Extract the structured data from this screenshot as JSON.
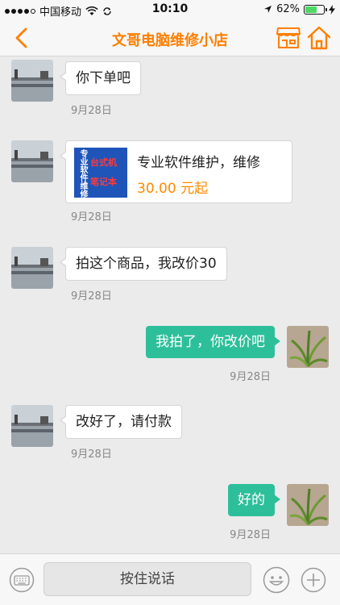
{
  "status": {
    "carrier": "中国移动",
    "time": "10:10",
    "battery": "62%",
    "battery_level": 0.62,
    "icons": [
      "signal-dots-icon",
      "wifi-icon",
      "sync-icon",
      "location-arrow-icon",
      "battery-icon",
      "charging-bolt-icon"
    ]
  },
  "nav": {
    "title": "文哥电脑维修小店",
    "icons": [
      "back-chevron-icon",
      "shop-icon",
      "home-icon"
    ],
    "accent": "#ff7f00"
  },
  "messages": [
    {
      "side": "in",
      "text": "你下单吧",
      "time": "9月28日"
    },
    {
      "side": "in",
      "type": "product",
      "product": {
        "name": "专业软件维护，维修",
        "price": "30.00 元起",
        "thumb_vertical": "专业软件维修",
        "thumb_line1": "台式机",
        "thumb_line2": "笔记本"
      },
      "time": "9月28日"
    },
    {
      "side": "in",
      "text": "拍这个商品，我改价30",
      "time": "9月28日"
    },
    {
      "side": "out",
      "text": "我拍了，你改价吧",
      "time": "9月28日"
    },
    {
      "side": "in",
      "text": "改好了，请付款",
      "time": "9月28日"
    },
    {
      "side": "out",
      "text": "好的",
      "time": "9月28日"
    }
  ],
  "bottom": {
    "voice_label": "按住说话",
    "icons": [
      "keyboard-icon",
      "emoji-icon",
      "plus-icon"
    ]
  },
  "colors": {
    "out_bubble": "#2dbf9a",
    "price": "#ff8a00"
  }
}
